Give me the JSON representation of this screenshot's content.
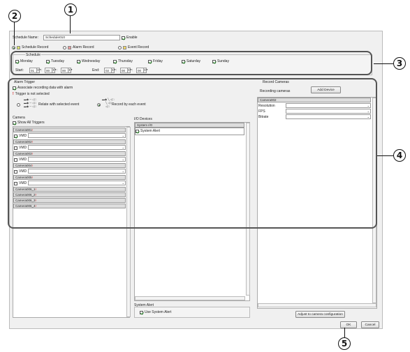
{
  "callouts": {
    "c1": "1",
    "c2": "2",
    "c3": "3",
    "c4": "4",
    "c5": "5"
  },
  "top": {
    "schedule_name_label": "Schedule Name:",
    "schedule_name_value": "Schedule010",
    "enable_label": "Enable",
    "schedule_record": "Schedule Record",
    "alarm_record": "Alarm Record",
    "event_record": "Event Record"
  },
  "schedule": {
    "title": "Schedule",
    "days": [
      "Monday",
      "Tuesday",
      "Wednesday",
      "Thursday",
      "Friday",
      "Saturday",
      "Sunday"
    ],
    "start_label": "Start:",
    "end_label": "End:",
    "start": [
      "01",
      "00",
      "00"
    ],
    "end": [
      "02",
      "00",
      "00"
    ]
  },
  "alarm": {
    "title": "Alarm Trigger",
    "associate": "Associate recording data with alarm",
    "not_selected": "Trigger is not selected",
    "relate_label": "Relate with selected event",
    "record_each_label": "Record by each event",
    "camera_label": "Camera",
    "show_all": "Show All Triggers",
    "cameras": [
      {
        "name": "Camera001",
        "vmd": "VMD",
        "checked": true,
        "has_vmd": true
      },
      {
        "name": "Camera002",
        "vmd": "VMD",
        "checked": false,
        "has_vmd": true
      },
      {
        "name": "Camera003",
        "vmd": "VMD",
        "checked": false,
        "has_vmd": true
      },
      {
        "name": "Camera004",
        "vmd": "VMD",
        "checked": false,
        "has_vmd": true
      },
      {
        "name": "Camera005",
        "vmd": "VMD",
        "checked": false,
        "has_vmd": true
      },
      {
        "name": "Camera006_1",
        "has_vmd": false
      },
      {
        "name": "Camera006_2",
        "has_vmd": false
      },
      {
        "name": "Camera006_3",
        "has_vmd": false
      },
      {
        "name": "Camera006_4",
        "has_vmd": false
      }
    ],
    "io_label": "I/O Devices",
    "system_io": "System I/O",
    "system_alert": "System Alert",
    "system_alert_group": "System Alert",
    "use_system_alert": "Use System Alert"
  },
  "record_cameras": {
    "title": "Record Cameras",
    "recording_label": "Recording cameras",
    "add_device": "Add Device",
    "camera": "Camera002",
    "rows": [
      "Resolution",
      "FPS",
      "Bitrate"
    ],
    "adjust": "Adjust to camera configuration"
  },
  "footer": {
    "ok": "OK",
    "cancel": "Cancel"
  }
}
